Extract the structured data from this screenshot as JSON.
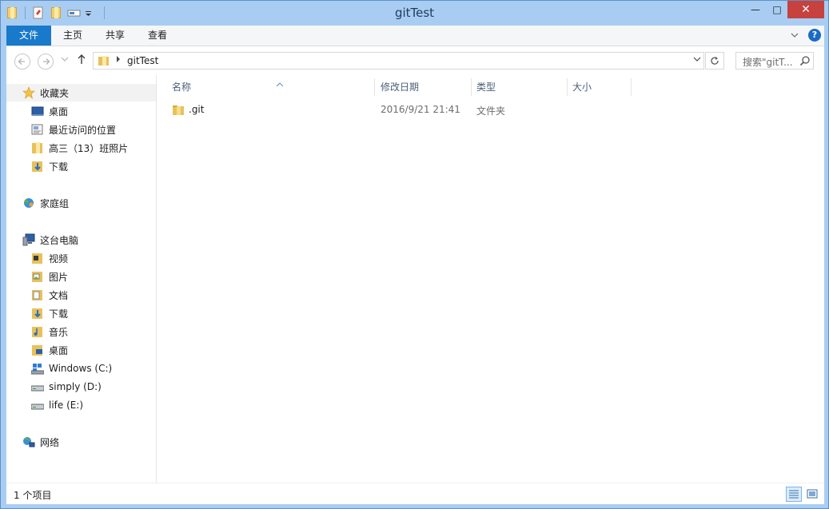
{
  "window": {
    "title": "gitTest"
  },
  "titlebar": {
    "minimize_glyph": "—",
    "maximize_glyph": "□",
    "close_glyph": "✕"
  },
  "ribbon": {
    "tabs": [
      "文件",
      "主页",
      "共享",
      "查看"
    ],
    "help_glyph": "?"
  },
  "address": {
    "path": "gitTest",
    "search_placeholder": "搜索\"gitT..."
  },
  "nav": {
    "favorites": {
      "label": "收藏夹",
      "items": [
        "桌面",
        "最近访问的位置",
        "高三（13）班照片",
        "下载"
      ]
    },
    "homegroup": {
      "label": "家庭组"
    },
    "thispc": {
      "label": "这台电脑",
      "items": [
        "视频",
        "图片",
        "文档",
        "下载",
        "音乐",
        "桌面",
        "Windows (C:)",
        "simply (D:)",
        "life (E:)"
      ]
    },
    "network": {
      "label": "网络"
    }
  },
  "columns": [
    "名称",
    "修改日期",
    "类型",
    "大小"
  ],
  "files": [
    {
      "name": ".git",
      "modified": "2016/9/21 21:41",
      "type": "文件夹",
      "size": ""
    }
  ],
  "status": {
    "text": "1 个项目"
  },
  "colors": {
    "titlebar": "#a9cdf2",
    "file_tab": "#1979ca",
    "close_button": "#c7413f",
    "folder": "#e8c15a"
  }
}
